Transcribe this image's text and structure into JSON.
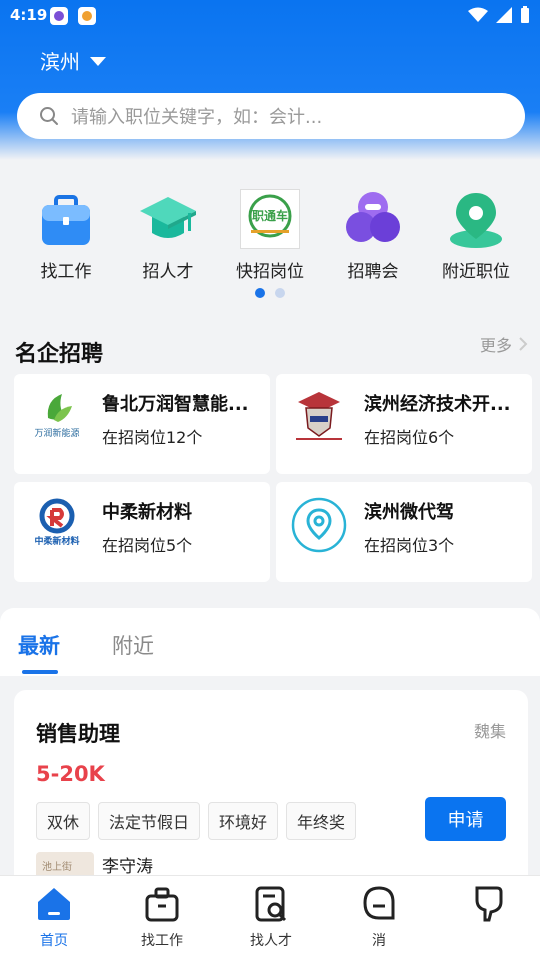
{
  "status_bar": {
    "time": "4:19"
  },
  "header": {
    "city": "滨州"
  },
  "search": {
    "placeholder": "请输入职位关键字，如：会计..."
  },
  "quick_menu": [
    {
      "label": "找工作",
      "icon": "briefcase-icon"
    },
    {
      "label": "招人才",
      "icon": "graduation-cap-icon"
    },
    {
      "label": "快招岗位",
      "icon": "zhitongche-logo-icon",
      "logo_text": "职通车"
    },
    {
      "label": "招聘会",
      "icon": "circles-icon"
    },
    {
      "label": "附近职位",
      "icon": "map-pin-icon"
    }
  ],
  "page_indicator": {
    "count": 2,
    "active": 0
  },
  "companies_section": {
    "title": "名企招聘",
    "more_label": "更多"
  },
  "companies": [
    {
      "name": "鲁北万润智慧能...",
      "count_text": "在招岗位12个",
      "logo_caption": "万润新能源"
    },
    {
      "name": "滨州经济技术开...",
      "count_text": "在招岗位6个"
    },
    {
      "name": "中柔新材料",
      "count_text": "在招岗位5个",
      "logo_caption": "中柔新材料"
    },
    {
      "name": "滨州微代驾",
      "count_text": "在招岗位3个"
    }
  ],
  "tabs": [
    {
      "label": "最新",
      "active": true
    },
    {
      "label": "附近",
      "active": false
    }
  ],
  "job": {
    "title": "销售助理",
    "location": "魏集",
    "salary": "5-20K",
    "tags": [
      "双休",
      "法定节假日",
      "环境好",
      "年终奖"
    ],
    "apply_label": "申请",
    "recruiter": "李守涛",
    "thumb_text": "池上街"
  },
  "bottom_nav": [
    {
      "label": "首页",
      "icon": "home-icon",
      "active": true
    },
    {
      "label": "找工作",
      "icon": "briefcase-outline-icon",
      "active": false
    },
    {
      "label": "找人才",
      "icon": "document-search-icon",
      "active": false
    },
    {
      "label": "消",
      "icon": "chat-icon",
      "active": false
    },
    {
      "label": "",
      "icon": "profile-icon",
      "active": false
    }
  ],
  "colors": {
    "primary": "#1a73e8",
    "salary": "#e8424b",
    "header": "#0a74f0"
  }
}
